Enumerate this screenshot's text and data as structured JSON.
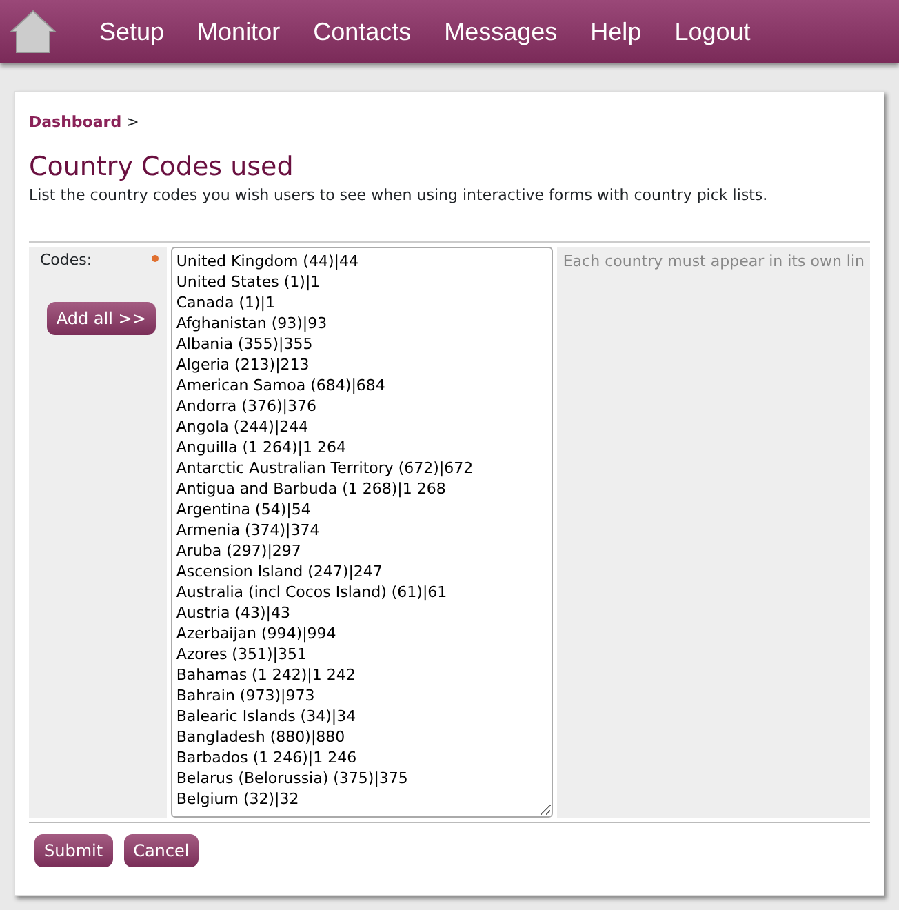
{
  "nav": {
    "items": [
      "Setup",
      "Monitor",
      "Contacts",
      "Messages",
      "Help",
      "Logout"
    ]
  },
  "breadcrumb": {
    "link": "Dashboard",
    "separator": ">"
  },
  "page": {
    "title": "Country Codes used",
    "description": "List the country codes you wish users to see when using interactive forms with country pick lists."
  },
  "form": {
    "label": "Codes:",
    "required": true,
    "add_all_button": "Add all >>",
    "codes": [
      "United Kingdom (44)|44",
      "United States (1)|1",
      "Canada (1)|1",
      "Afghanistan (93)|93",
      "Albania (355)|355",
      "Algeria (213)|213",
      "American Samoa (684)|684",
      "Andorra (376)|376",
      "Angola (244)|244",
      "Anguilla (1 264)|1 264",
      "Antarctic Australian Territory (672)|672",
      "Antigua and Barbuda (1 268)|1 268",
      "Argentina (54)|54",
      "Armenia (374)|374",
      "Aruba (297)|297",
      "Ascension Island (247)|247",
      "Australia (incl Cocos Island) (61)|61",
      "Austria (43)|43",
      "Azerbaijan (994)|994",
      "Azores (351)|351",
      "Bahamas (1 242)|1 242",
      "Bahrain (973)|973",
      "Balearic Islands (34)|34",
      "Bangladesh (880)|880",
      "Barbados (1 246)|1 246",
      "Belarus (Belorussia) (375)|375",
      "Belgium (32)|32"
    ],
    "help": "Each country must appear in its own lin"
  },
  "buttons": [
    "Submit",
    "Cancel"
  ]
}
